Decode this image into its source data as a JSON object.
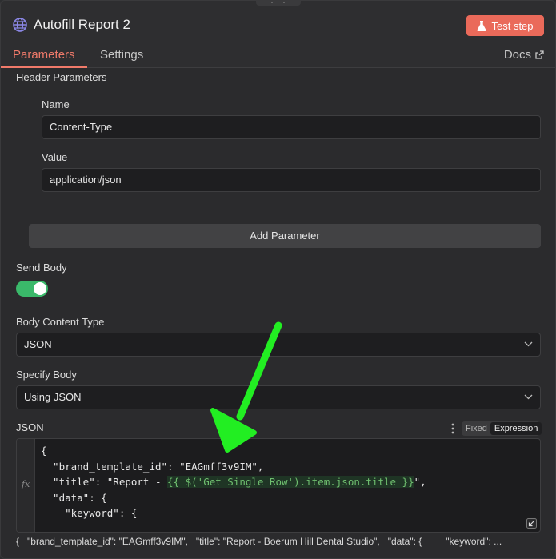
{
  "window": {
    "title": "Autofill Report 2",
    "test_step_label": "Test step"
  },
  "tabs": {
    "parameters": "Parameters",
    "settings": "Settings",
    "docs": "Docs"
  },
  "header_parameters": {
    "section_label": "Header Parameters",
    "name_label": "Name",
    "name_value": "Content-Type",
    "value_label": "Value",
    "value_value": "application/json",
    "add_button": "Add Parameter"
  },
  "body": {
    "send_body_label": "Send Body",
    "send_body_enabled": true,
    "content_type_label": "Body Content Type",
    "content_type_value": "JSON",
    "specify_body_label": "Specify Body",
    "specify_body_value": "Using JSON",
    "json_label": "JSON",
    "mode_fixed": "Fixed",
    "mode_expression": "Expression",
    "code_line1": "{",
    "code_line2": "  \"brand_template_id\": \"EAGmff3v9IM\",",
    "code_line3_pre": "  \"title\": \"Report - ",
    "code_line3_expr": "{{ $('Get Single Row').item.json.title }}",
    "code_line3_post": "\",",
    "code_line4": "  \"data\": {",
    "code_line5": "",
    "code_line6": "    \"keyword\": {",
    "preview": "{   \"brand_template_id\": \"EAGmff3v9IM\",   \"title\": \"Report - Boerum Hill Dental Studio\",   \"data\": {         \"keyword\": ..."
  },
  "icons": {
    "node": "globe-icon",
    "test": "flask-icon",
    "docs": "external-link-icon",
    "expr": "fx-icon"
  },
  "colors": {
    "accent": "#f07a6a",
    "test_button": "#ea6a5a",
    "toggle_on": "#3ab96a",
    "annotation_arrow": "#22ee22"
  }
}
